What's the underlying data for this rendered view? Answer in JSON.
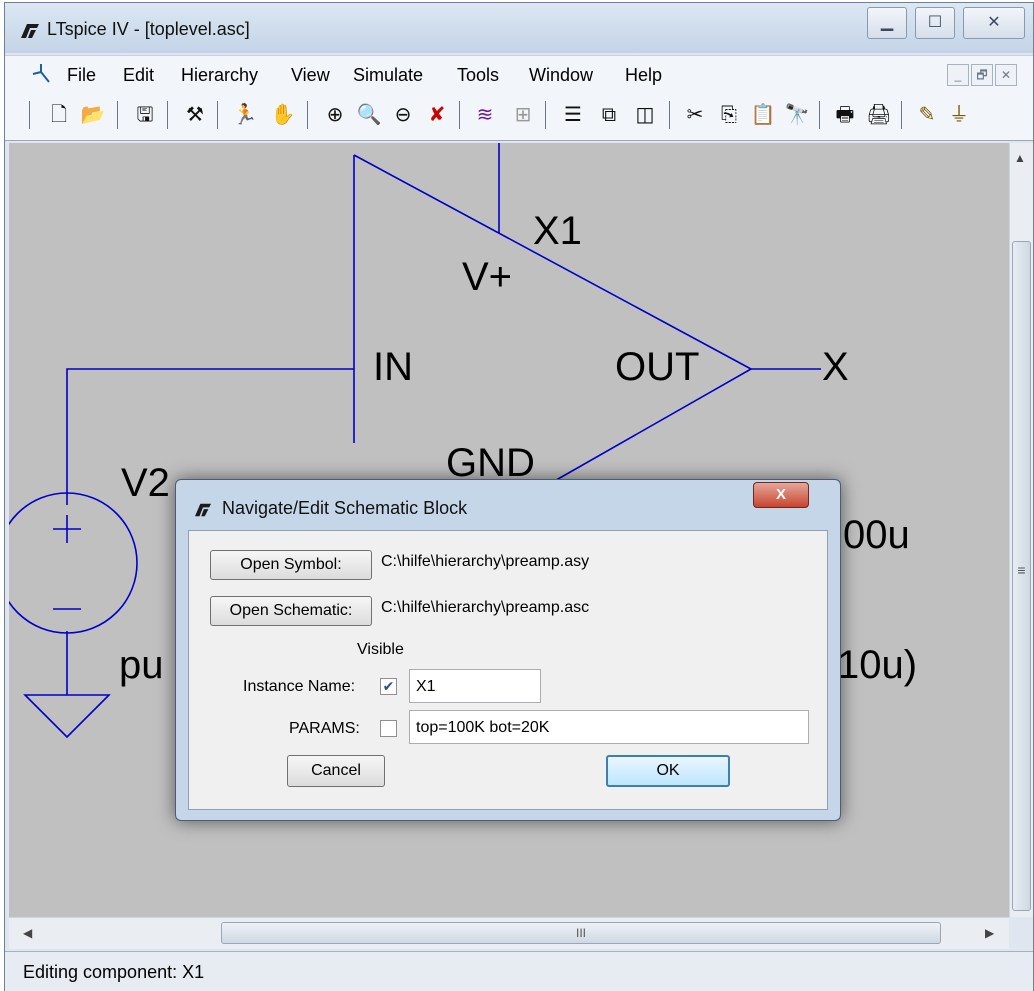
{
  "window": {
    "title": "LTspice IV - [toplevel.asc]",
    "caption_buttons": {
      "minimize": "▁",
      "maximize": "☐",
      "close": "✕"
    }
  },
  "menu": {
    "items": [
      "File",
      "Edit",
      "Hierarchy",
      "View",
      "Simulate",
      "Tools",
      "Window",
      "Help"
    ],
    "mdi_buttons": [
      "_",
      "🗗",
      "✕"
    ]
  },
  "toolbar": {
    "icons": [
      "new-schematic-icon",
      "open-icon",
      "save-icon",
      "control-panel-icon",
      "run-icon",
      "halt-icon",
      "zoom-to-icon",
      "zoom-in-icon",
      "zoom-out-icon",
      "zoom-fit-icon",
      "autorange-icon",
      "grid-icon",
      "tile-horizontal-icon",
      "cascade-icon",
      "tile-vertical-icon",
      "cut-icon",
      "copy-icon",
      "paste-icon",
      "find-icon",
      "print-preview-icon",
      "print-icon",
      "draw-wire-icon",
      "ground-icon"
    ]
  },
  "schematic": {
    "labels": {
      "instance": "X1",
      "vplus": "V+",
      "in": "IN",
      "out": "OUT",
      "gnd": "GND",
      "x": "X",
      "v2": "V2",
      "partial_right_1": "00u",
      "partial_left": "pu",
      "partial_right_2": "10u)"
    }
  },
  "hscroll": {
    "thumb_glyph": "III"
  },
  "vscroll": {
    "thumb_glyph": "≡"
  },
  "status": {
    "text": "Editing component: X1"
  },
  "dialog": {
    "title": "Navigate/Edit Schematic Block",
    "close_glyph": "X",
    "open_symbol_label": "Open Symbol:",
    "symbol_path": "C:\\hilfe\\hierarchy\\preamp.asy",
    "open_schematic_label": "Open Schematic:",
    "schematic_path": "C:\\hilfe\\hierarchy\\preamp.asc",
    "visible_header": "Visible",
    "instance_name_label": "Instance Name:",
    "instance_name_visible": true,
    "instance_name_value": "X1",
    "params_label": "PARAMS:",
    "params_visible": false,
    "params_value": "top=100K bot=20K",
    "cancel_label": "Cancel",
    "ok_label": "OK"
  },
  "colors": {
    "canvas": "#c0c0c0",
    "wire": "#0000c8",
    "dialog_frame": "#c5d6e8",
    "close_red": "#c8452f"
  }
}
